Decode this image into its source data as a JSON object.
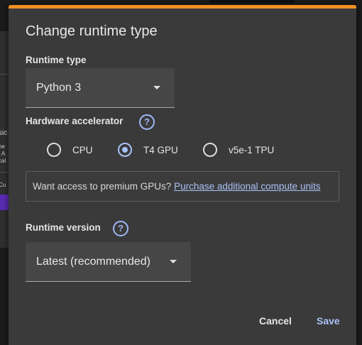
{
  "background": {
    "fragments": [
      "sic",
      "he",
      "t A",
      "cal",
      "Cu"
    ]
  },
  "dialog": {
    "title": "Change runtime type",
    "accent_color": "#f08f23",
    "runtime_type": {
      "label": "Runtime type",
      "selected": "Python 3",
      "caret_icon": "triangle-down-icon"
    },
    "hardware_accelerator": {
      "label": "Hardware accelerator",
      "help_icon": "question-circle-icon",
      "help_glyph": "?",
      "options": [
        {
          "label": "CPU",
          "checked": false
        },
        {
          "label": "T4 GPU",
          "checked": true
        },
        {
          "label": "v5e-1 TPU",
          "checked": false
        }
      ]
    },
    "premium": {
      "text": "Want access to premium GPUs?",
      "link": "Purchase additional compute units"
    },
    "runtime_version": {
      "label": "Runtime version",
      "help_icon": "question-circle-icon",
      "help_glyph": "?",
      "selected": "Latest (recommended)",
      "caret_icon": "triangle-down-icon"
    },
    "buttons": {
      "cancel": "Cancel",
      "save": "Save"
    }
  }
}
